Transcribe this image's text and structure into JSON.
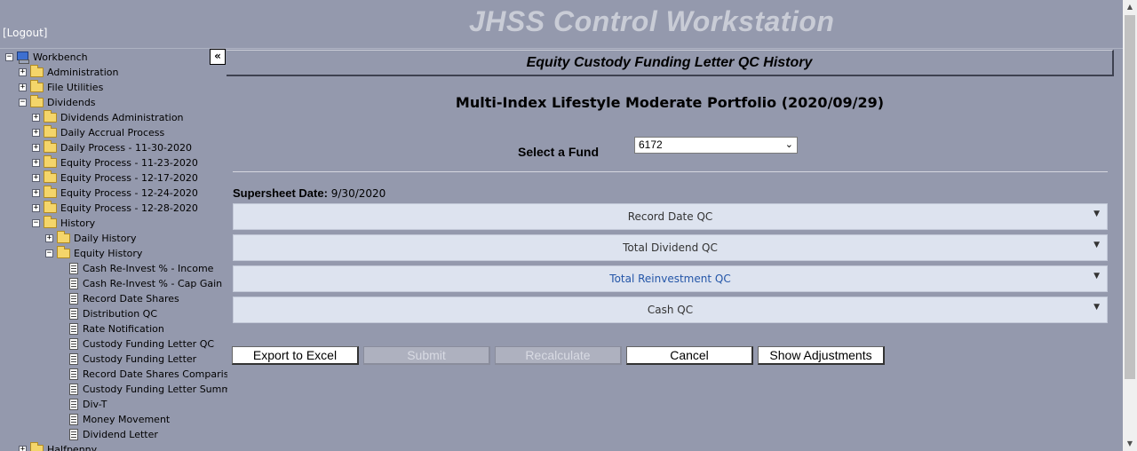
{
  "header": {
    "logout_label": "[Logout]",
    "app_title": "JHSS Control Workstation"
  },
  "sidebar": {
    "collapse_label": "«",
    "tree": [
      {
        "label": "Workbench",
        "type": "pc",
        "expander": "−",
        "indent": 0
      },
      {
        "label": "Administration",
        "type": "folder",
        "expander": "+",
        "indent": 1
      },
      {
        "label": "File Utilities",
        "type": "folder",
        "expander": "+",
        "indent": 1
      },
      {
        "label": "Dividends",
        "type": "folder",
        "expander": "−",
        "indent": 1
      },
      {
        "label": "Dividends Administration",
        "type": "folder",
        "expander": "+",
        "indent": 2
      },
      {
        "label": "Daily Accrual Process",
        "type": "folder",
        "expander": "+",
        "indent": 2
      },
      {
        "label": "Daily Process - 11-30-2020",
        "type": "folder",
        "expander": "+",
        "indent": 2
      },
      {
        "label": "Equity Process - 11-23-2020",
        "type": "folder",
        "expander": "+",
        "indent": 2
      },
      {
        "label": "Equity Process - 12-17-2020",
        "type": "folder",
        "expander": "+",
        "indent": 2
      },
      {
        "label": "Equity Process - 12-24-2020",
        "type": "folder",
        "expander": "+",
        "indent": 2
      },
      {
        "label": "Equity Process - 12-28-2020",
        "type": "folder",
        "expander": "+",
        "indent": 2
      },
      {
        "label": "History",
        "type": "folder",
        "expander": "−",
        "indent": 2
      },
      {
        "label": "Daily History",
        "type": "folder",
        "expander": "+",
        "indent": 3
      },
      {
        "label": "Equity History",
        "type": "folder",
        "expander": "−",
        "indent": 3
      },
      {
        "label": "Cash Re-Invest % - Income",
        "type": "page",
        "indent": 4
      },
      {
        "label": "Cash Re-Invest % - Cap Gain",
        "type": "page",
        "indent": 4
      },
      {
        "label": "Record Date Shares",
        "type": "page",
        "indent": 4
      },
      {
        "label": "Distribution QC",
        "type": "page",
        "indent": 4
      },
      {
        "label": "Rate Notification",
        "type": "page",
        "indent": 4
      },
      {
        "label": "Custody Funding Letter QC",
        "type": "page",
        "indent": 4
      },
      {
        "label": "Custody Funding Letter",
        "type": "page",
        "indent": 4
      },
      {
        "label": "Record Date Shares Comparison",
        "type": "page",
        "indent": 4
      },
      {
        "label": "Custody Funding Letter Summary",
        "type": "page",
        "indent": 4
      },
      {
        "label": "Div-T",
        "type": "page",
        "indent": 4
      },
      {
        "label": "Money Movement",
        "type": "page",
        "indent": 4
      },
      {
        "label": "Dividend Letter",
        "type": "page",
        "indent": 4
      },
      {
        "label": "Halfpenny",
        "type": "folder",
        "expander": "+",
        "indent": 1
      }
    ]
  },
  "main": {
    "panel_title": "Equity Custody Funding Letter QC History",
    "portfolio_title": "Multi-Index Lifestyle Moderate Portfolio (2020/09/29)",
    "fund_label": "Select a Fund",
    "fund_value": "6172",
    "supersheet_label": "Supersheet Date:",
    "supersheet_value": "9/30/2020",
    "sections": [
      "Record Date QC",
      "Total Dividend QC",
      "Total Reinvestment QC",
      "Cash QC"
    ],
    "buttons": {
      "export": "Export to Excel",
      "submit": "Submit",
      "recalculate": "Recalculate",
      "cancel": "Cancel",
      "show_adjustments": "Show Adjustments"
    }
  },
  "colors": {
    "background": "#9499ad",
    "accordion": "#dde3ef",
    "link_blue": "#2456a8"
  }
}
